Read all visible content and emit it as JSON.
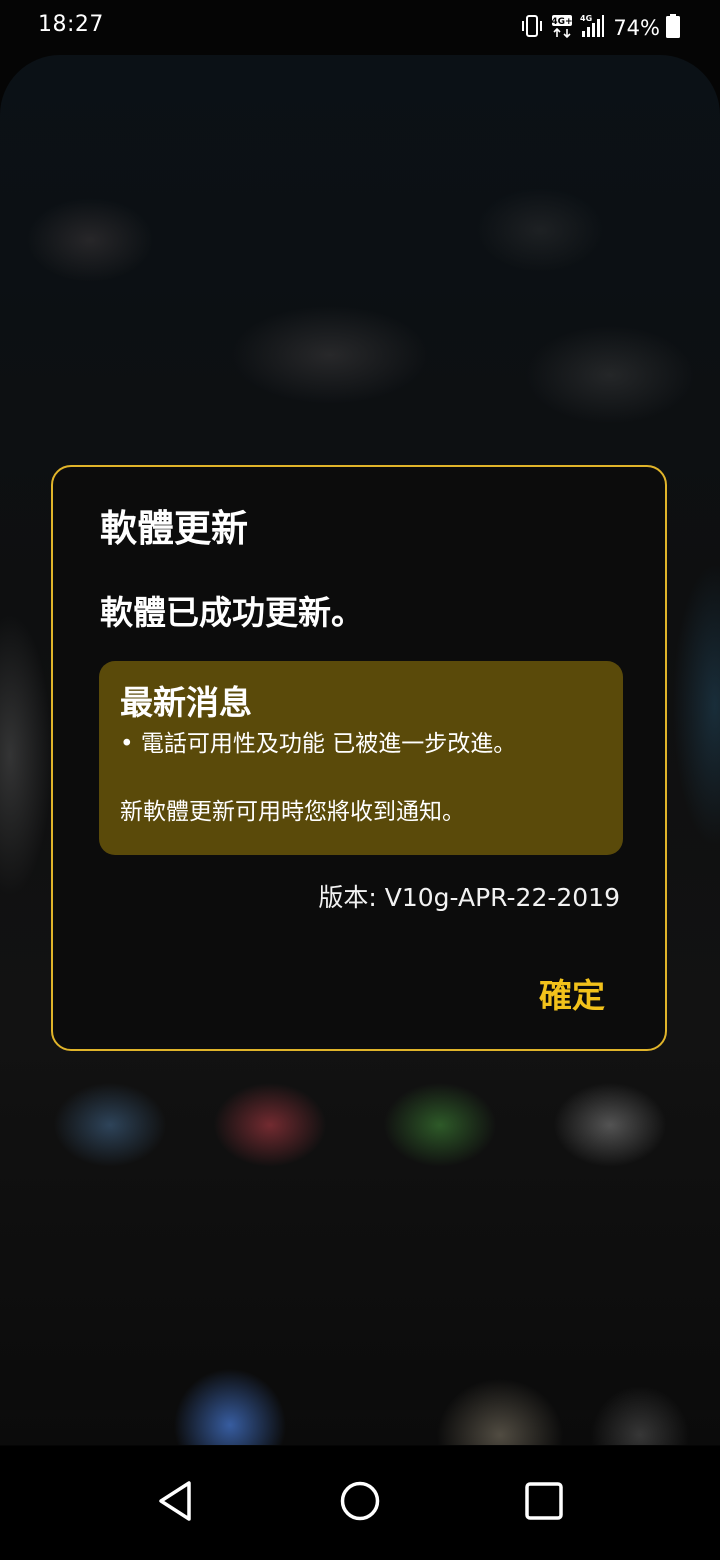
{
  "status_bar": {
    "time": "18:27",
    "network_badge": "4G+",
    "signal_badge": "4G",
    "battery_percent": "74%"
  },
  "dialog": {
    "title": "軟體更新",
    "message": "軟體已成功更新。",
    "news": {
      "heading": "最新消息",
      "item": "• 電話可用性及功能 已被進一步改進。",
      "note": "新軟體更新可用時您將收到通知。"
    },
    "version": "版本: V10g-APR-22-2019",
    "confirm_label": "確定"
  },
  "nav_bar": {
    "icons": [
      "back-icon",
      "home-icon",
      "recents-icon"
    ]
  },
  "colors": {
    "accent": "#f2c21b",
    "dialog_border": "#e0b42a",
    "news_background": "#5a4a0a",
    "dialog_background": "#0c0c0c"
  }
}
